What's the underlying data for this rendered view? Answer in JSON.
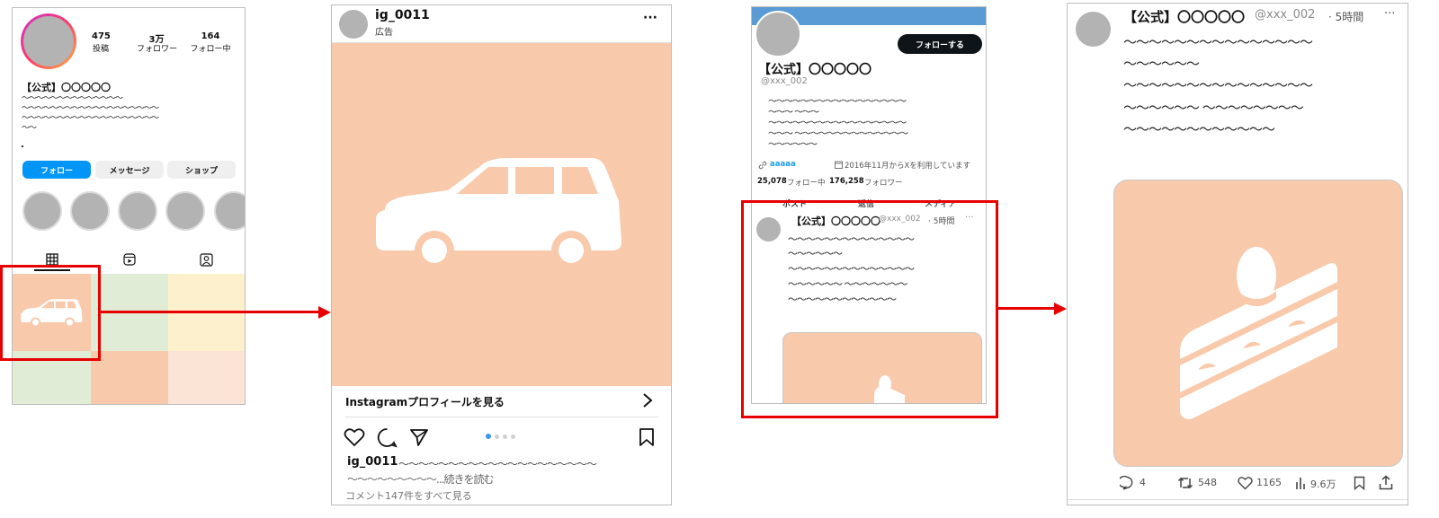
{
  "ig_profile": {
    "stats": [
      {
        "value": "475",
        "label": "投稿"
      },
      {
        "value": "3万",
        "label": "フォロワー"
      },
      {
        "value": "164",
        "label": "フォロー中"
      }
    ],
    "name": "【公式】〇〇〇〇〇",
    "bio_lines": [
      "〜〜〜〜〜〜〜〜〜〜〜〜〜〜",
      "〜〜〜〜〜〜〜〜〜〜〜〜〜〜〜〜〜〜〜",
      "〜〜〜〜〜〜〜〜〜〜〜〜〜〜〜〜〜〜〜",
      "〜〜"
    ],
    "dot": "・",
    "follow_label": "フォロー",
    "message_label": "メッセージ",
    "shop_label": "ショップ",
    "grid_colors": [
      "#f8c9ab",
      "#e1ecd6",
      "#fdf1cd",
      "#e1ecd6",
      "#f8c9ab",
      "#fbe3d6"
    ]
  },
  "ig_post": {
    "username": "ig_0011",
    "sponsored": "広告",
    "more": "···",
    "profile_link": "Instagramプロフィールを見る",
    "caption_user": "ig_0011",
    "caption_line1": "〜〜〜〜〜〜〜〜〜〜〜〜〜〜〜〜〜〜〜〜",
    "caption_line2": "〜〜〜〜〜〜〜〜〜...続きを読む",
    "comments": "コメント147件をすべて見る"
  },
  "x_profile": {
    "follow_button": "フォローする",
    "name": "【公式】〇〇〇〇〇",
    "handle": "@xxx_002",
    "bio_lines": [
      "〜〜〜〜〜〜〜〜〜〜〜〜〜〜〜〜〜",
      "〜〜〜 〜〜〜",
      "〜〜〜〜〜〜〜〜〜〜〜〜〜〜〜〜〜",
      "〜〜〜 〜〜〜〜〜〜〜〜〜〜〜〜〜〜",
      "〜〜〜〜〜〜"
    ],
    "link_text": "aaaaa",
    "joined": "2016年11月からXを利用しています",
    "following_count": "25,078",
    "following_label": "フォロー中",
    "followers_count": "176,258",
    "followers_label": "フォロワー",
    "tabs": [
      "ポスト",
      "返信",
      "メディア"
    ],
    "post_name": "【公式】〇〇〇〇〇",
    "post_handle": "@xxx_002",
    "post_time": "· 5時間",
    "post_more": "···",
    "post_lines": [
      "〜〜〜〜〜〜〜〜〜〜〜〜〜〜",
      "〜〜〜〜〜〜",
      "〜〜〜〜〜〜〜〜〜〜〜〜〜〜",
      "〜〜〜〜〜〜 〜〜〜〜〜〜〜",
      "〜〜〜〜〜〜〜〜〜〜〜〜"
    ]
  },
  "x_post": {
    "name": "【公式】〇〇〇〇〇",
    "handle": "@xxx_002",
    "time": "· 5時間",
    "more": "···",
    "lines": [
      "〜〜〜〜〜〜〜〜〜〜〜〜〜〜〜",
      "〜〜〜〜〜〜",
      "〜〜〜〜〜〜〜〜〜〜〜〜〜〜〜",
      "〜〜〜〜〜〜 〜〜〜〜〜〜〜〜",
      "〜〜〜〜〜〜〜〜〜〜〜〜"
    ],
    "replies": "4",
    "reposts": "548",
    "likes": "1165",
    "views": "9.6万"
  }
}
